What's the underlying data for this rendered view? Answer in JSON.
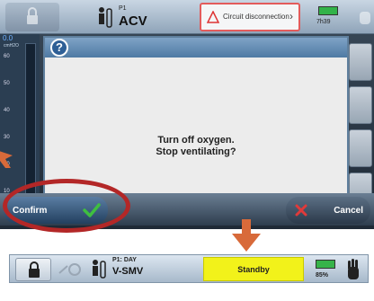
{
  "top_screen": {
    "statusbar": {
      "patient_label": "P1",
      "mode": "ACV",
      "alarm_text": "Circuit disconnection",
      "battery_time": "7h39"
    },
    "scale": {
      "value": "0.0",
      "unit": "cmH2O",
      "ticks": [
        "60",
        "50",
        "40",
        "30",
        "20",
        "10"
      ]
    },
    "dialog": {
      "message_line1": "Turn off oxygen.",
      "message_line2": "Stop ventilating?"
    },
    "actions": {
      "confirm_label": "Confirm",
      "cancel_label": "Cancel"
    }
  },
  "bottom_preview": {
    "patient_label": "P1: DAY",
    "mode": "V-SMV",
    "status": "Standby",
    "battery_pct": "85%"
  },
  "colors": {
    "alarm_border": "#e35b5b",
    "standby_bg": "#f2f21a",
    "annotation_red": "#b32727",
    "arrow_orange": "#d86a3a",
    "check_green": "#3fbf3f",
    "cancel_red": "#e03a3a"
  }
}
